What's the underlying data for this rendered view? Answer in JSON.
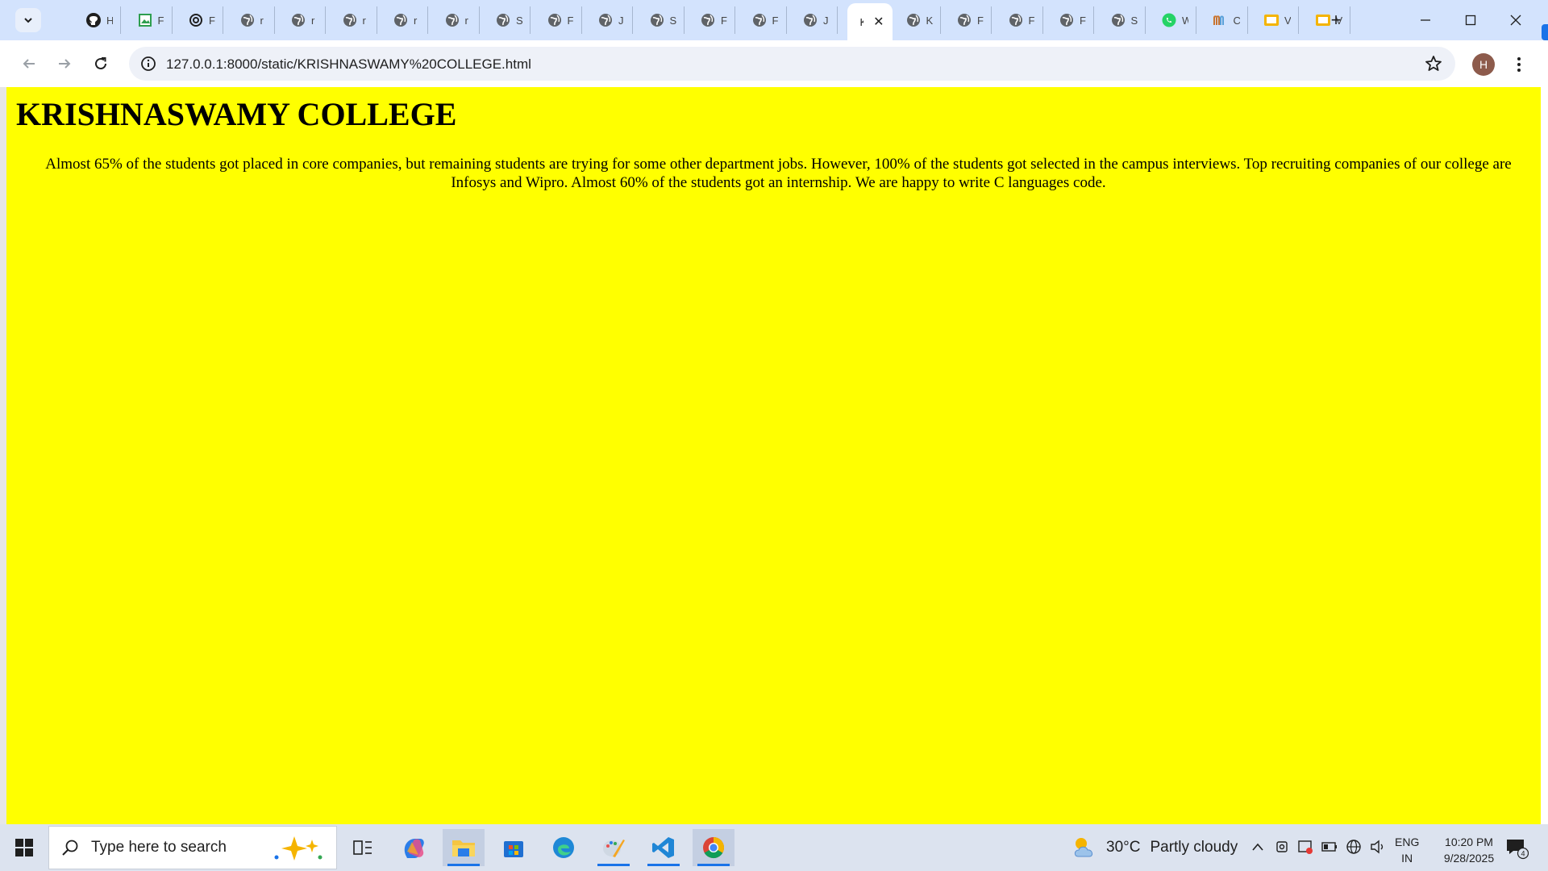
{
  "browser": {
    "tabs": [
      {
        "label": "H",
        "icon": "github-icon"
      },
      {
        "label": "F",
        "icon": "image-file-icon"
      },
      {
        "label": "F",
        "icon": "openai-icon"
      },
      {
        "label": "r",
        "icon": "globe-icon"
      },
      {
        "label": "r",
        "icon": "globe-icon"
      },
      {
        "label": "r",
        "icon": "globe-icon"
      },
      {
        "label": "r",
        "icon": "globe-icon"
      },
      {
        "label": "r",
        "icon": "globe-icon"
      },
      {
        "label": "S",
        "icon": "globe-icon"
      },
      {
        "label": "F",
        "icon": "globe-icon"
      },
      {
        "label": "J",
        "icon": "globe-icon"
      },
      {
        "label": "S",
        "icon": "globe-icon"
      },
      {
        "label": "F",
        "icon": "globe-icon"
      },
      {
        "label": "F",
        "icon": "globe-icon"
      },
      {
        "label": "J",
        "icon": "globe-icon"
      },
      {
        "label": "K",
        "icon": "none",
        "active": true
      },
      {
        "label": "K",
        "icon": "globe-icon"
      },
      {
        "label": "F",
        "icon": "globe-icon"
      },
      {
        "label": "F",
        "icon": "globe-icon"
      },
      {
        "label": "F",
        "icon": "globe-icon"
      },
      {
        "label": "S",
        "icon": "globe-icon"
      },
      {
        "label": "W",
        "icon": "whatsapp-icon"
      },
      {
        "label": "C",
        "icon": "m-logo-icon"
      },
      {
        "label": "V",
        "icon": "slides-icon"
      },
      {
        "label": "V",
        "icon": "slides-icon"
      }
    ],
    "url": "127.0.0.1:8000/static/KRISHNASWAMY%20COLLEGE.html",
    "profile_initial": "H"
  },
  "page": {
    "title": "KRISHNASWAMY COLLEGE",
    "paragraph": "Almost 65% of the students got placed in core companies, but remaining students are trying for some other department jobs. However, 100% of the students got selected in the campus interviews. Top recruiting companies of our college are Infosys and Wipro. Almost 60% of the students got an internship. We are happy to write C languages code.",
    "background_color": "#ffff00"
  },
  "taskbar": {
    "search_placeholder": "Type here to search",
    "weather_temp": "30°C",
    "weather_condition": "Partly cloudy",
    "lang_line1": "ENG",
    "lang_line2": "IN",
    "time": "10:20 PM",
    "date": "9/28/2025",
    "notification_count": "4"
  }
}
